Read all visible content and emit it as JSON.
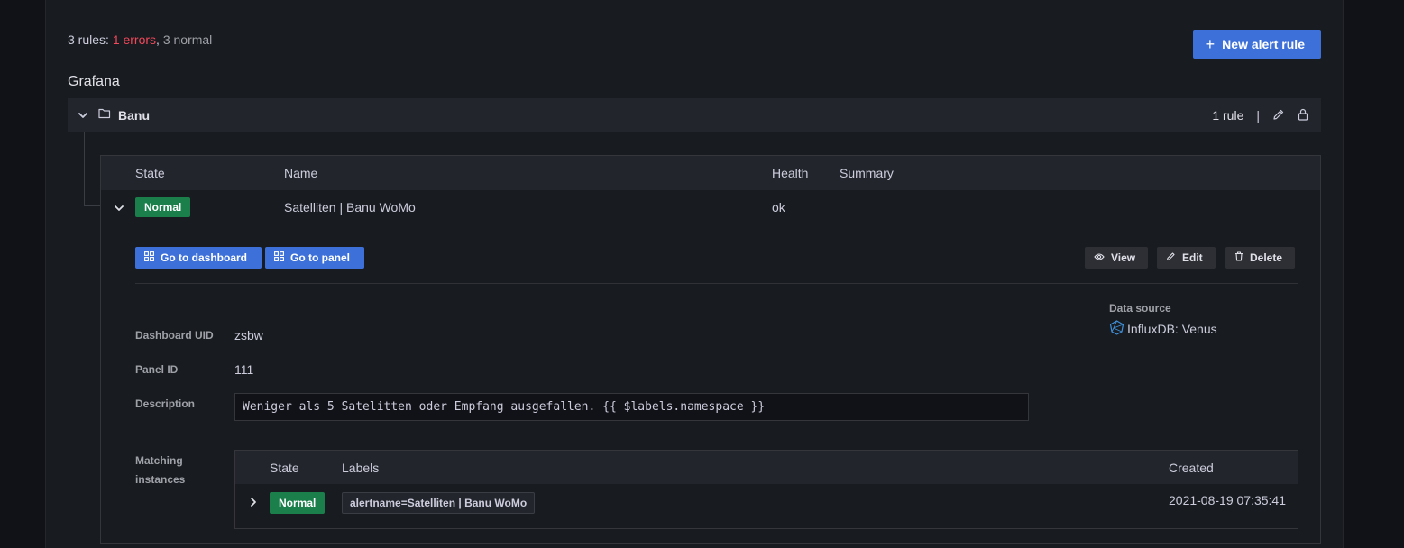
{
  "summary": {
    "prefix": "3 rules: ",
    "errors": "1 errors",
    "sep": ", ",
    "normal": "3 normal"
  },
  "new_rule_button": "New alert rule",
  "section_title": "Grafana",
  "folder": {
    "name": "Banu",
    "rule_count": "1 rule",
    "pipe": "|"
  },
  "table": {
    "headers": {
      "state": "State",
      "name": "Name",
      "health": "Health",
      "summary": "Summary"
    },
    "rule": {
      "state": "Normal",
      "name": "Satelliten | Banu WoMo",
      "health": "ok",
      "summary": ""
    }
  },
  "actions": {
    "go_dashboard": "Go to dashboard",
    "go_panel": "Go to panel",
    "view": "View",
    "edit": "Edit",
    "delete": "Delete"
  },
  "details": {
    "dashboard_uid_label": "Dashboard UID",
    "dashboard_uid": "zsbw",
    "panel_id_label": "Panel ID",
    "panel_id": "111",
    "description_label": "Description",
    "description": "Weniger als 5 Satelitten oder Empfang ausgefallen. {{ $labels.namespace }}",
    "datasource_label": "Data source",
    "datasource": "InfluxDB: Venus",
    "matching_label_1": "Matching",
    "matching_label_2": "instances"
  },
  "instances": {
    "headers": {
      "state": "State",
      "labels": "Labels",
      "created": "Created"
    },
    "rows": [
      {
        "state": "Normal",
        "label": "alertname=Satelliten | Banu WoMo",
        "created": "2021-08-19 07:35:41"
      }
    ]
  },
  "colors": {
    "accent": "#3d71d9",
    "error": "#f2495c",
    "normal_badge": "#1a7f4b"
  },
  "icons": [
    "plus-icon",
    "chevron-down-icon",
    "folder-icon",
    "pencil-icon",
    "lock-icon",
    "grid-icon",
    "eye-icon",
    "trash-icon",
    "influxdb-icon",
    "chevron-right-icon"
  ]
}
